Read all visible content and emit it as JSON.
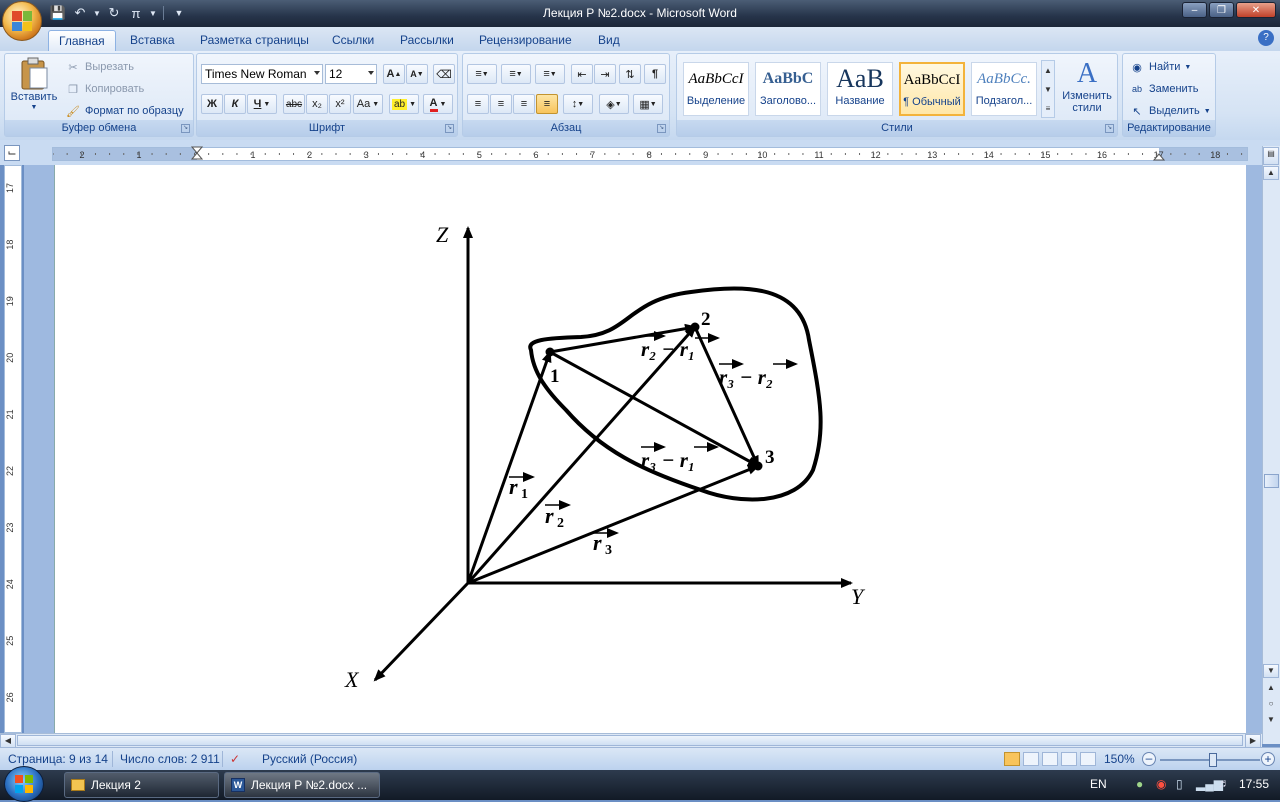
{
  "window": {
    "title": "Лекция Р №2.docx - Microsoft Word"
  },
  "tabs": [
    "Главная",
    "Вставка",
    "Разметка страницы",
    "Ссылки",
    "Рассылки",
    "Рецензирование",
    "Вид"
  ],
  "active_tab": "Главная",
  "clipboard": {
    "paste": "Вставить",
    "cut": "Вырезать",
    "copy": "Копировать",
    "format_painter": "Формат по образцу",
    "caption": "Буфер обмена"
  },
  "font": {
    "name": "Times New Roman",
    "size": "12",
    "caption": "Шрифт",
    "bold": "Ж",
    "italic": "К",
    "underline": "Ч",
    "strike": "abc",
    "subscript": "x₂",
    "superscript": "x²",
    "case": "Aa"
  },
  "paragraph": {
    "caption": "Абзац"
  },
  "styles": {
    "caption": "Стили",
    "items": [
      {
        "preview": "AaBbCcI",
        "name": "Выделение"
      },
      {
        "preview": "AaBbC",
        "name": "Заголово..."
      },
      {
        "preview": "AaB",
        "name": "Название"
      },
      {
        "preview": "AaBbCcI",
        "name": "¶ Обычный"
      },
      {
        "preview": "AaBbCc.",
        "name": "Подзагол..."
      }
    ],
    "change_styles": "Изменить стили"
  },
  "editing": {
    "caption": "Редактирование",
    "find": "Найти",
    "replace": "Заменить",
    "select": "Выделить"
  },
  "ruler": {
    "h_labels": [
      "2",
      "1",
      "1",
      "1",
      "2",
      "3",
      "4",
      "5",
      "6",
      "7",
      "8",
      "9",
      "10",
      "11",
      "12",
      "13",
      "14",
      "15",
      "16",
      "17",
      "18"
    ],
    "v_labels": [
      "17",
      "18",
      "19",
      "20",
      "21",
      "22",
      "23",
      "24",
      "25",
      "26"
    ]
  },
  "figure": {
    "axis_z": "Z",
    "axis_y": "Y",
    "axis_x": "X",
    "point_1": "1",
    "point_2": "2",
    "point_3": "3",
    "r1": "r",
    "r1_sub": "1",
    "r2": "r",
    "r2_sub": "2",
    "r3": "r",
    "r3_sub": "3",
    "r2_minus_r1": "r₂ − r₁",
    "r3_minus_r2": "r₃ − r₂",
    "r3_minus_r1": "r₃ − r₁"
  },
  "status": {
    "page": "Страница: 9 из 14",
    "words": "Число слов: 2 911",
    "language": "Русский (Россия)",
    "zoom": "150%"
  },
  "taskbar": {
    "items": [
      "Лекция 2",
      "Лекция Р №2.docx ..."
    ],
    "lang": "EN",
    "time": "17:55"
  }
}
